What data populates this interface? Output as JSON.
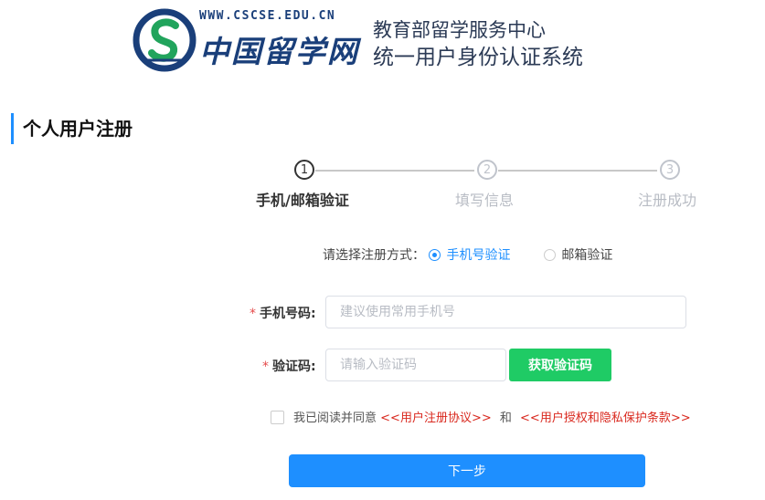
{
  "header": {
    "site_url": "WWW.CSCSE.EDU.CN",
    "brand": "中国留学网",
    "org_line1": "教育部留学服务中心",
    "org_line2": "统一用户身份认证系统"
  },
  "page_title": "个人用户注册",
  "steps": [
    {
      "number": "1",
      "label": "手机/邮箱验证",
      "state": "active"
    },
    {
      "number": "2",
      "label": "填写信息",
      "state": "todo"
    },
    {
      "number": "3",
      "label": "注册成功",
      "state": "todo"
    }
  ],
  "method": {
    "label": "请选择注册方式：",
    "options": [
      {
        "label": "手机号验证",
        "checked": true
      },
      {
        "label": "邮箱验证",
        "checked": false
      }
    ]
  },
  "form": {
    "phone": {
      "required_mark": "*",
      "label": "手机号码:",
      "placeholder": "建议使用常用手机号",
      "value": ""
    },
    "code": {
      "required_mark": "*",
      "label": "验证码:",
      "placeholder": "请输入验证码",
      "value": ""
    },
    "get_code_label": "获取验证码"
  },
  "agreement": {
    "prefix": "我已阅读并同意",
    "link1": "<<用户注册协议>>",
    "and": "和",
    "link2": "<<用户授权和隐私保护条款>>",
    "checked": false
  },
  "next_label": "下一步",
  "colors": {
    "accent": "#1e8fff",
    "code_button": "#1fcb65",
    "link": "#d9281e",
    "brand": "#1a3f7a"
  }
}
